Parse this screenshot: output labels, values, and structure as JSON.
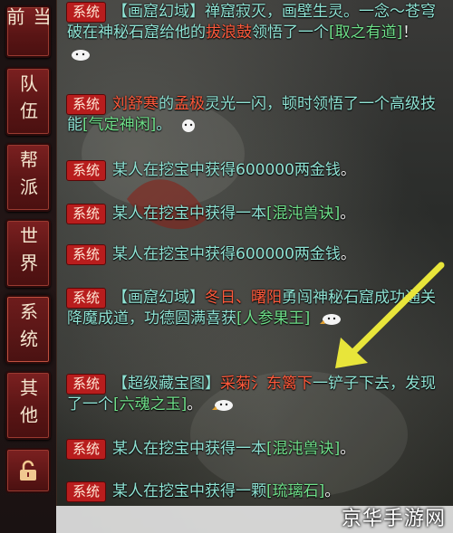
{
  "tabs": [
    {
      "label": "当前"
    },
    {
      "label": "队伍"
    },
    {
      "label": "帮派"
    },
    {
      "label": "世界"
    },
    {
      "label": "系统",
      "active": true
    },
    {
      "label": "其他"
    }
  ],
  "lock_icon": "lock-open-icon",
  "badge_label": "系统",
  "messages": {
    "m1": {
      "p1": "【画窟幻域】禅窟寂灭，画壁生灵。",
      "p2": "一念～苍穹破",
      "p3": "在神秘石窟给他的",
      "p4": "拔浪鼓",
      "p5": "领悟了一个",
      "p6": "[取之有道]",
      "p7": "！"
    },
    "m2": {
      "p1": "刘舒寒",
      "p2": "的",
      "p3": "孟极",
      "p4": "灵光一闪，顿时领悟了一个高级技能",
      "p5": "[气定神闲]",
      "p6": "。"
    },
    "m3": {
      "p1": "某人在挖宝中获得600000两金钱",
      "p2": "。"
    },
    "m4": {
      "p1": "某人在挖宝中获得一本",
      "p2": "[混沌兽诀]",
      "p3": "。"
    },
    "m5": {
      "p1": "某人在挖宝中获得600000两金钱",
      "p2": "。"
    },
    "m6": {
      "p1": "【画窟幻域】",
      "p2": "冬日、曙阳",
      "p3": "勇闯神秘石窟成功通关降魔成道，功德圆满喜获",
      "p4": "[人参果王]"
    },
    "m7": {
      "p1": "【超级藏宝图】",
      "p2": "采菊氵东篱下",
      "p3": "一铲子下去，发现了一个",
      "p4": "[六魂之玉]",
      "p5": "。"
    },
    "m8": {
      "p1": "某人在挖宝中获得一本",
      "p2": "[混沌兽诀]",
      "p3": "。"
    },
    "m9": {
      "p1": "某人在挖宝中获得一颗",
      "p2": "[琉璃石]",
      "p3": "。"
    }
  },
  "watermark": "京华手游网",
  "colors": {
    "badge": "#b81d1d",
    "text": "#8fe3d4",
    "player": "#ff5a3c",
    "item": "#6fe08a",
    "arrow": "#e8e53a"
  }
}
